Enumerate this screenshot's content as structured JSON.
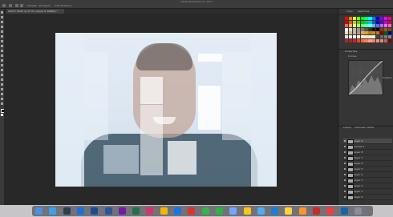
{
  "titlebar": {
    "title": "Adobe Photoshop CC 2017"
  },
  "optionsbar": {
    "items": [
      "Sample:",
      "All Layers",
      "Auto-Enhance"
    ]
  },
  "document": {
    "tab_title": "ASV27 Darth @ 33.3% (Layer 9, RGB/8) *"
  },
  "panels": {
    "color_tab": "Color",
    "swatches_tab": "Swatches",
    "properties_tab": "Properties",
    "curves_label": "Curves",
    "preset_label": "Preset:",
    "preset_value": "Custom",
    "layers_tab": "Layers",
    "channels_tab": "Channels",
    "paths_tab": "Paths"
  },
  "layers": [
    {
      "name": "Layer 9"
    },
    {
      "name": "Curves 1"
    },
    {
      "name": "Layer 8"
    },
    {
      "name": "Layer 7"
    },
    {
      "name": "Layer 6"
    },
    {
      "name": "Layer 5"
    },
    {
      "name": "Layer 4"
    },
    {
      "name": "Layer 3"
    },
    {
      "name": "Layer 2"
    },
    {
      "name": "Layer 1"
    },
    {
      "name": "Layer 0"
    }
  ],
  "colors": {
    "panel_bg": "#353535",
    "canvas_bg": "#282828",
    "shirt": "#496172",
    "dock_bg": "#c7c5c8"
  },
  "dock": {
    "apps": [
      "finder-icon",
      "safari-icon",
      "lightroom-icon",
      "photoshop-icon",
      "lightroom-cc-icon",
      "word-icon",
      "onenote-icon",
      "excel-icon",
      "itunes-icon",
      "photos-icon",
      "app-store-icon",
      "calendar-icon",
      "maps-icon",
      "messages-icon",
      "preview-icon",
      "chrome-icon",
      "finder-alt-icon",
      "mail-icon",
      "notes-icon",
      "reminders-icon",
      "acrobat-icon",
      "music-icon",
      "ps-alt-icon",
      "trash-icon"
    ]
  }
}
